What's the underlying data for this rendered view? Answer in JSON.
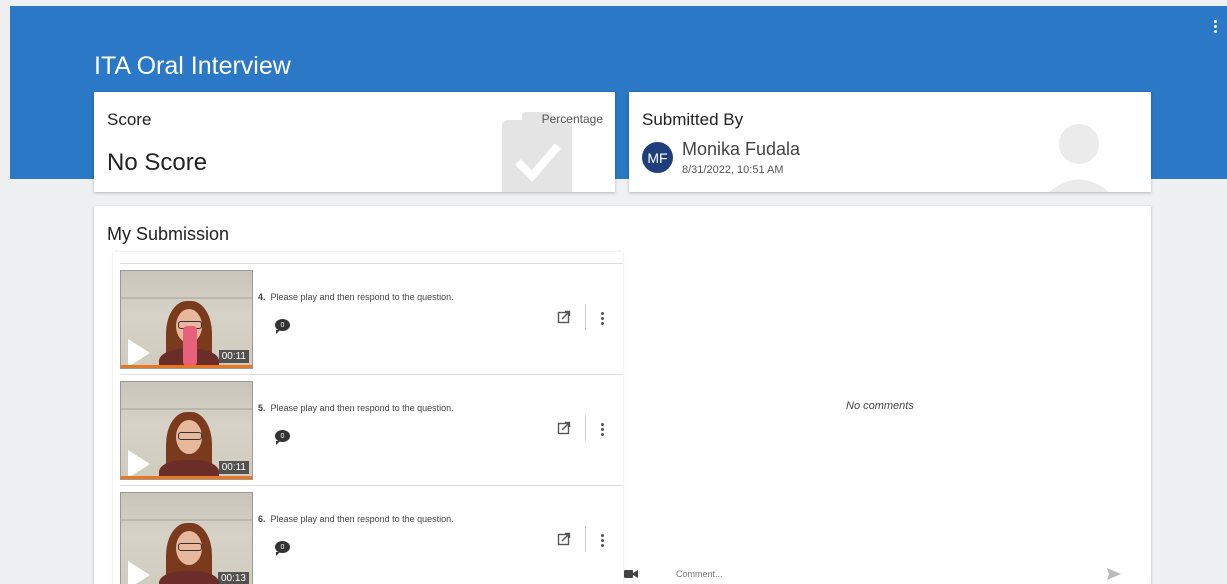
{
  "page": {
    "title": "ITA Oral Interview"
  },
  "score_card": {
    "heading": "Score",
    "type": "Percentage",
    "value": "No Score"
  },
  "submitted_card": {
    "heading": "Submitted By",
    "initials": "MF",
    "name": "Monika Fudala",
    "date": "8/31/2022, 10:51 AM"
  },
  "submission": {
    "heading": "My Submission",
    "items": [
      {
        "number": "4.",
        "question": "Please play and then respond to the question.",
        "duration": "00:11",
        "comments": "0"
      },
      {
        "number": "5.",
        "question": "Please play and then respond to the question.",
        "duration": "00:11",
        "comments": "0"
      },
      {
        "number": "6.",
        "question": "Please play and then respond to the question.",
        "duration": "00:13",
        "comments": "0"
      }
    ],
    "comments_empty": "No comments",
    "comment_placeholder": "Comment..."
  },
  "icons": {
    "banner_menu": "kebab-menu-icon",
    "score_bg": "clipboard-check-icon",
    "submitter_bg": "person-icon",
    "open": "open-in-new-icon",
    "item_menu": "kebab-menu-icon",
    "comments": "comment-bubble-icon",
    "video": "video-camera-icon",
    "send": "send-icon"
  },
  "colors": {
    "banner": "#2b78c6",
    "avatar": "#1f3f7a",
    "progress": "#e87722"
  }
}
